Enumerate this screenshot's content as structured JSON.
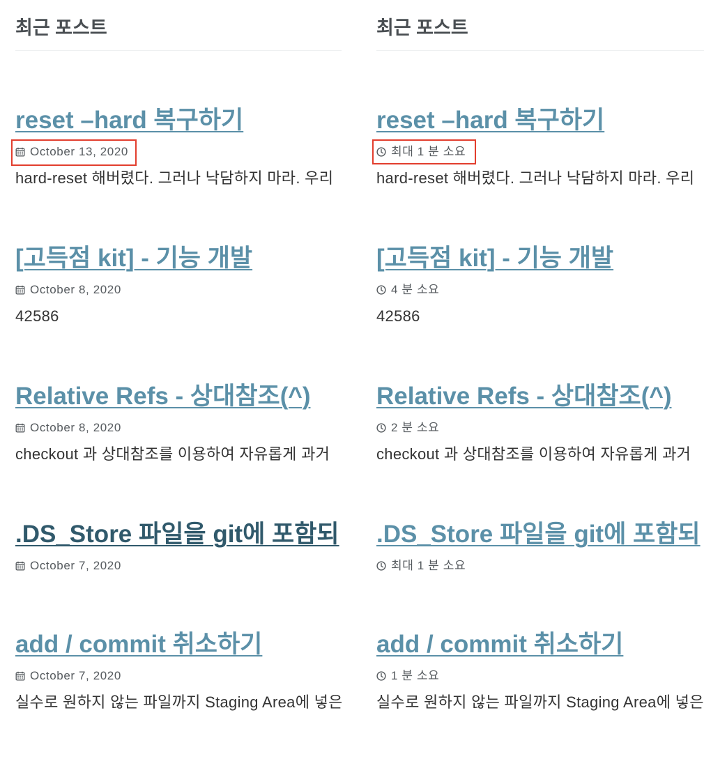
{
  "colors": {
    "link": "#5b90a8",
    "link_active": "#30596b",
    "heading": "#494e52",
    "meta": "#555a5e",
    "excerpt": "#333333",
    "border": "#eef0f1",
    "highlight": "#e23e2e"
  },
  "columns": [
    {
      "heading": "최근 포스트",
      "meta_icon": "calendar-icon",
      "posts": [
        {
          "title": "reset –hard 복구하기",
          "meta": "October 13, 2020",
          "excerpt": "hard-reset 해버렸다. 그러나 낙담하지 마라. 우리",
          "highlighted": true
        },
        {
          "title": "[고득점 kit] - 기능 개발",
          "meta": "October 8, 2020",
          "excerpt": "42586"
        },
        {
          "title": "Relative Refs - 상대참조(^)",
          "meta": "October 8, 2020",
          "excerpt": "checkout 과 상대참조를 이용하여 자유롭게 과거"
        },
        {
          "title": ".DS_Store 파일을 git에 포함되",
          "meta": "October 7, 2020",
          "active": true
        },
        {
          "title": "add / commit 취소하기",
          "meta": "October 7, 2020",
          "excerpt": "실수로 원하지 않는 파일까지 Staging Area에 넣은"
        }
      ]
    },
    {
      "heading": "최근 포스트",
      "meta_icon": "clock-icon",
      "posts": [
        {
          "title": "reset –hard 복구하기",
          "meta": "최대 1 분 소요",
          "excerpt": "hard-reset 해버렸다. 그러나 낙담하지 마라. 우리",
          "highlighted": true
        },
        {
          "title": "[고득점 kit] - 기능 개발",
          "meta": "4 분 소요",
          "excerpt": "42586"
        },
        {
          "title": "Relative Refs - 상대참조(^)",
          "meta": "2 분 소요",
          "excerpt": "checkout 과 상대참조를 이용하여 자유롭게 과거"
        },
        {
          "title": ".DS_Store 파일을 git에 포함되",
          "meta": "최대 1 분 소요"
        },
        {
          "title": "add / commit 취소하기",
          "meta": "1 분 소요",
          "excerpt": "실수로 원하지 않는 파일까지 Staging Area에 넣은"
        }
      ]
    }
  ]
}
